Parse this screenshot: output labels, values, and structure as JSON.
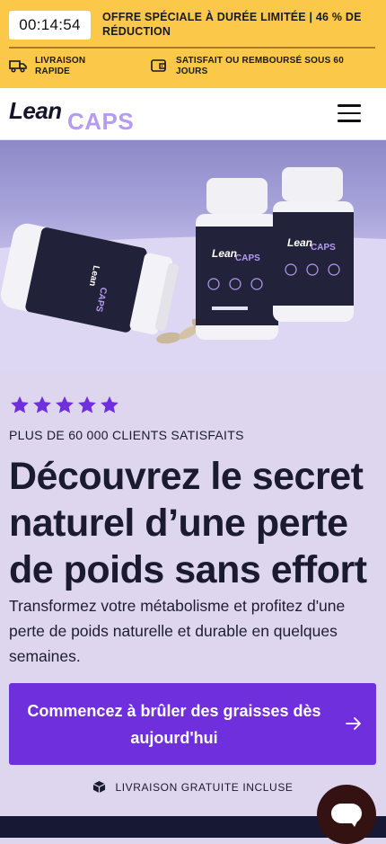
{
  "promo": {
    "timer": "00:14:54",
    "offer_text": "OFFRE SPÉCIALE À DURÉE LIMITÉE | 46 % DE RÉDUCTION",
    "perks": [
      {
        "icon": "truck-icon",
        "label": "LIVRAISON RAPIDE"
      },
      {
        "icon": "wallet-icon",
        "label": "SATISFAIT OU REMBOURSÉ SOUS 60 JOURS"
      }
    ]
  },
  "header": {
    "logo_lean": "Lean",
    "logo_caps": "CAPS",
    "menu_icon": "hamburger-icon"
  },
  "hero": {
    "bottle_logo_lean": "Lean",
    "bottle_logo_caps": "CAPS"
  },
  "content": {
    "rating_stars": 5,
    "customers": "PLUS DE 60 000 CLIENTS SATISFAITS",
    "headline": "Découvrez le secret naturel d’une perte de poids sans effort",
    "subtitle": "Transformez votre métabolisme et profitez d'une perte de poids naturelle et durable en quelques semaines.",
    "cta_label": "Commencez à brûler des graisses dès aujourd'hui",
    "shipping_text": "LIVRAISON GRATUITE INCLUSE"
  },
  "colors": {
    "promo_bg": "#fcc84a",
    "accent_purple": "#6f2fdc",
    "star": "#6f2fdc",
    "content_bg": "#ddd6ee",
    "dark_navy": "#161834",
    "chat_bg": "#341212"
  }
}
